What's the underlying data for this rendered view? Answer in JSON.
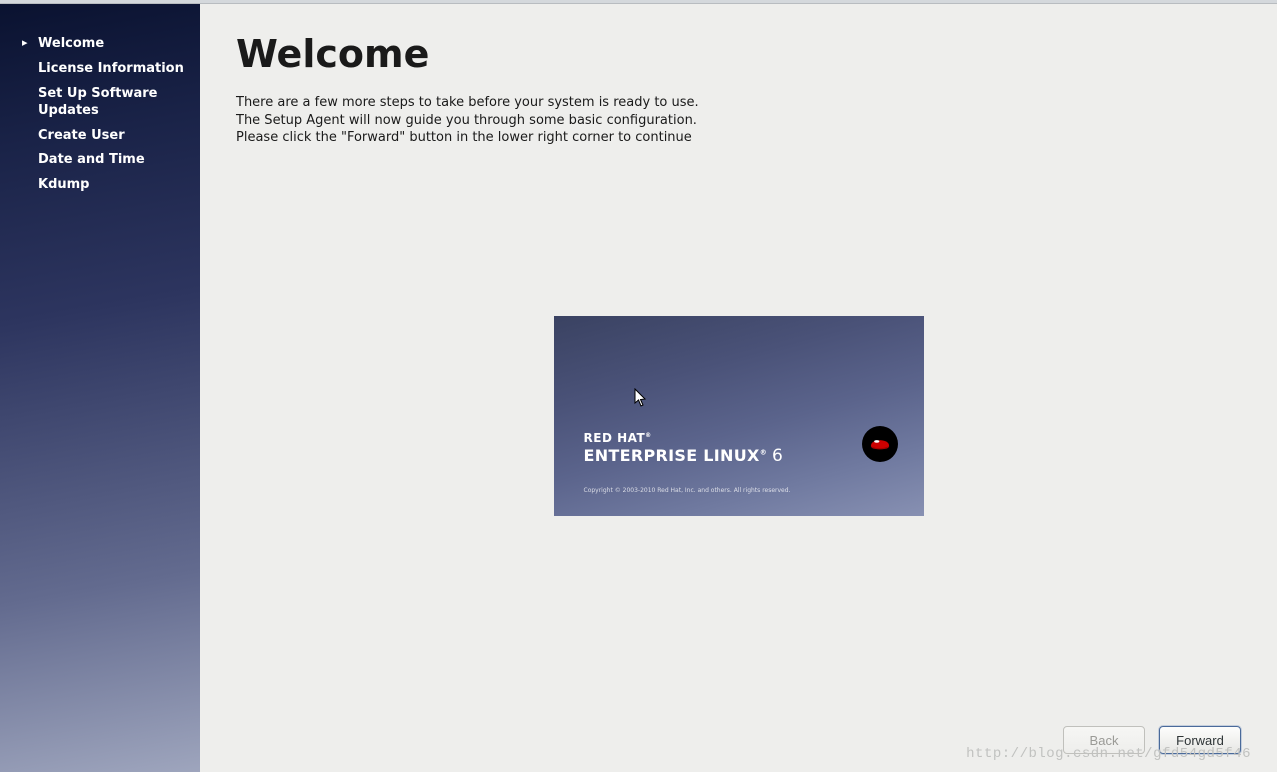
{
  "sidebar": {
    "items": [
      {
        "label": "Welcome",
        "active": true
      },
      {
        "label": "License Information",
        "active": false
      },
      {
        "label": "Set Up Software Updates",
        "active": false
      },
      {
        "label": "Create User",
        "active": false
      },
      {
        "label": "Date and Time",
        "active": false
      },
      {
        "label": "Kdump",
        "active": false
      }
    ]
  },
  "main": {
    "title": "Welcome",
    "paragraphs": [
      "There are a few more steps to take before your system is ready to use.",
      "The Setup Agent will now guide you through some basic configuration.",
      "Please click the \"Forward\" button in the lower right corner to continue"
    ]
  },
  "splash": {
    "brand_line1": "RED HAT",
    "brand_line2": "ENTERPRISE LINUX",
    "version": "6",
    "copyright": "Copyright © 2003-2010 Red Hat, Inc. and others. All rights reserved."
  },
  "footer": {
    "back_label": "Back",
    "forward_label": "Forward"
  },
  "watermark": "http://blog.csdn.net/gfd54gd5f46"
}
